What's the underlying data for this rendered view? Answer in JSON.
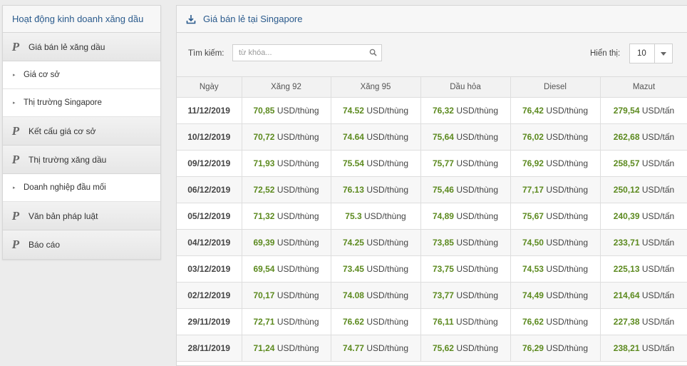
{
  "sidebar": {
    "title": "Hoạt động kinh doanh xăng dầu",
    "items": [
      {
        "type": "p",
        "label": "Giá bán lẻ xăng dầu"
      },
      {
        "type": "sub",
        "label": "Giá cơ sở"
      },
      {
        "type": "sub",
        "label": "Thị trường Singapore"
      },
      {
        "type": "p",
        "label": "Kết cấu giá cơ sở"
      },
      {
        "type": "p",
        "label": "Thị trường xăng dầu"
      },
      {
        "type": "sub",
        "label": "Doanh nghiệp đầu mối"
      },
      {
        "type": "p",
        "label": "Văn bản pháp luật"
      },
      {
        "type": "p",
        "label": "Báo cáo"
      }
    ],
    "p_icon": "P"
  },
  "panel": {
    "title": "Giá bán lẻ tại Singapore",
    "search_label": "Tìm kiếm:",
    "search_placeholder": "từ khóa...",
    "show_label": "Hiển thị:",
    "show_value": "10"
  },
  "table": {
    "headers": [
      "Ngày",
      "Xăng 92",
      "Xăng 95",
      "Dầu hỏa",
      "Diesel",
      "Mazut"
    ],
    "rows": [
      {
        "date": "11/12/2019",
        "cells": [
          [
            "70,85",
            "USD/thùng"
          ],
          [
            "74.52",
            "USD/thùng"
          ],
          [
            "76,32",
            "USD/thùng"
          ],
          [
            "76,42",
            "USD/thùng"
          ],
          [
            "279,54",
            "USD/tấn"
          ]
        ]
      },
      {
        "date": "10/12/2019",
        "cells": [
          [
            "70,72",
            "USD/thùng"
          ],
          [
            "74.64",
            "USD/thùng"
          ],
          [
            "75,64",
            "USD/thùng"
          ],
          [
            "76,02",
            "USD/thùng"
          ],
          [
            "262,68",
            "USD/tấn"
          ]
        ]
      },
      {
        "date": "09/12/2019",
        "cells": [
          [
            "71,93",
            "USD/thùng"
          ],
          [
            "75.54",
            "USD/thùng"
          ],
          [
            "75,77",
            "USD/thùng"
          ],
          [
            "76,92",
            "USD/thùng"
          ],
          [
            "258,57",
            "USD/tấn"
          ]
        ]
      },
      {
        "date": "06/12/2019",
        "cells": [
          [
            "72,52",
            "USD/thùng"
          ],
          [
            "76.13",
            "USD/thùng"
          ],
          [
            "75,46",
            "USD/thùng"
          ],
          [
            "77,17",
            "USD/thùng"
          ],
          [
            "250,12",
            "USD/tấn"
          ]
        ]
      },
      {
        "date": "05/12/2019",
        "cells": [
          [
            "71,32",
            "USD/thùng"
          ],
          [
            "75.3",
            "USD/thùng"
          ],
          [
            "74,89",
            "USD/thùng"
          ],
          [
            "75,67",
            "USD/thùng"
          ],
          [
            "240,39",
            "USD/tấn"
          ]
        ]
      },
      {
        "date": "04/12/2019",
        "cells": [
          [
            "69,39",
            "USD/thùng"
          ],
          [
            "74.25",
            "USD/thùng"
          ],
          [
            "73,85",
            "USD/thùng"
          ],
          [
            "74,50",
            "USD/thùng"
          ],
          [
            "233,71",
            "USD/tấn"
          ]
        ]
      },
      {
        "date": "03/12/2019",
        "cells": [
          [
            "69,54",
            "USD/thùng"
          ],
          [
            "73.45",
            "USD/thùng"
          ],
          [
            "73,75",
            "USD/thùng"
          ],
          [
            "74,53",
            "USD/thùng"
          ],
          [
            "225,13",
            "USD/tấn"
          ]
        ]
      },
      {
        "date": "02/12/2019",
        "cells": [
          [
            "70,17",
            "USD/thùng"
          ],
          [
            "74.08",
            "USD/thùng"
          ],
          [
            "73,77",
            "USD/thùng"
          ],
          [
            "74,49",
            "USD/thùng"
          ],
          [
            "214,64",
            "USD/tấn"
          ]
        ]
      },
      {
        "date": "29/11/2019",
        "cells": [
          [
            "72,71",
            "USD/thùng"
          ],
          [
            "76.62",
            "USD/thùng"
          ],
          [
            "76,11",
            "USD/thùng"
          ],
          [
            "76,62",
            "USD/thùng"
          ],
          [
            "227,38",
            "USD/tấn"
          ]
        ]
      },
      {
        "date": "28/11/2019",
        "cells": [
          [
            "71,24",
            "USD/thùng"
          ],
          [
            "74.77",
            "USD/thùng"
          ],
          [
            "75,62",
            "USD/thùng"
          ],
          [
            "76,29",
            "USD/thùng"
          ],
          [
            "238,21",
            "USD/tấn"
          ]
        ]
      }
    ]
  },
  "colors": {
    "title_blue": "#2a5a8c",
    "value_green": "#5c8a1f"
  }
}
